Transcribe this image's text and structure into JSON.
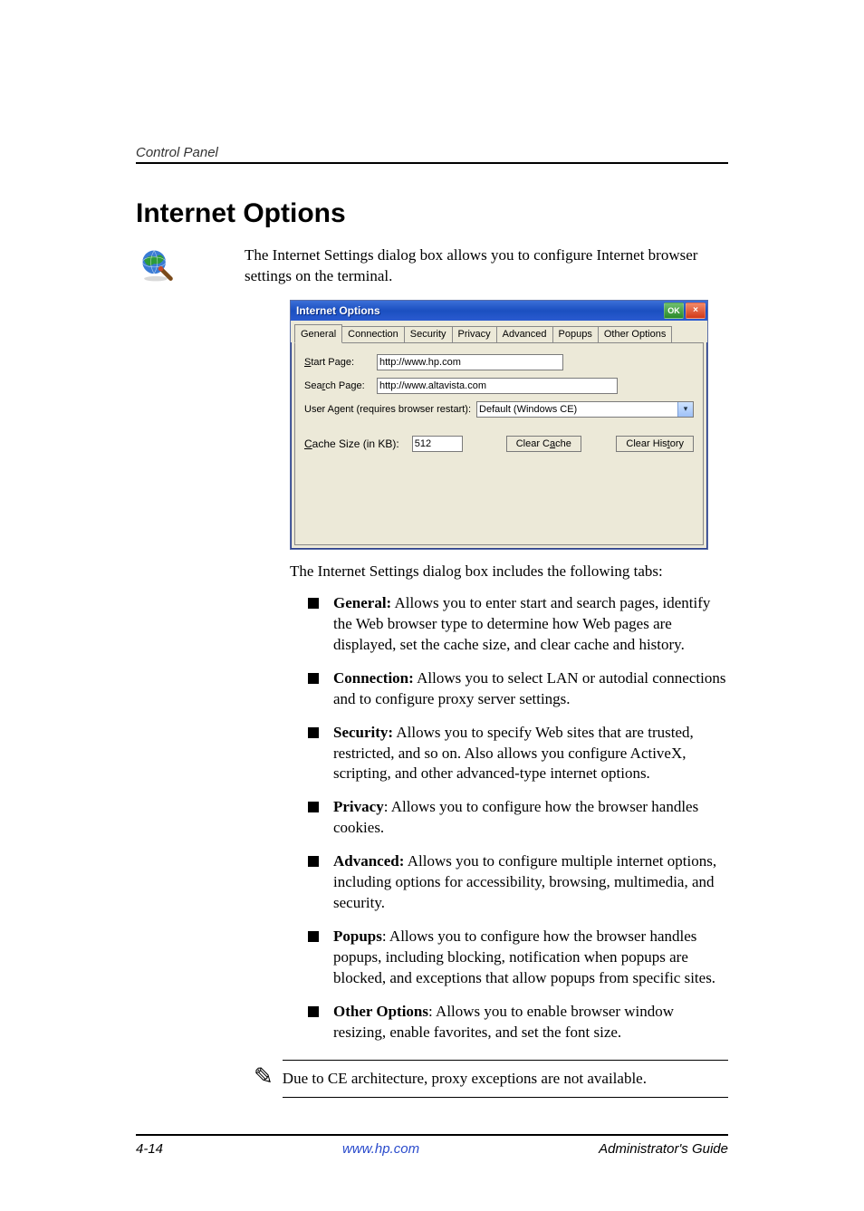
{
  "header": {
    "section": "Control Panel"
  },
  "title": "Internet Options",
  "intro": "The Internet Settings dialog box allows you to configure Internet browser settings on the terminal.",
  "dialog": {
    "title": "Internet Options",
    "ok_label": "OK",
    "close_label": "×",
    "tabs": [
      "General",
      "Connection",
      "Security",
      "Privacy",
      "Advanced",
      "Popups",
      "Other Options"
    ],
    "active_tab_index": 0,
    "general": {
      "start_page_label": "Start Page:",
      "start_page_value": "http://www.hp.com",
      "search_page_label": "Search Page:",
      "search_page_value": "http://www.altavista.com",
      "user_agent_label": "User Agent (requires browser restart):",
      "user_agent_value": "Default (Windows CE)",
      "cache_label": "Cache Size (in KB):",
      "cache_value": "512",
      "clear_cache_label": "Clear Cache",
      "clear_history_label": "Clear History"
    }
  },
  "after_dialog": "The Internet Settings dialog box includes the following tabs:",
  "tab_descriptions": [
    {
      "name": "General:",
      "text": " Allows you to enter start and search pages, identify the Web browser type to determine how Web pages are displayed, set the cache size, and clear cache and history."
    },
    {
      "name": "Connection:",
      "text": " Allows you to select LAN or autodial connections and to configure proxy server settings."
    },
    {
      "name": "Security:",
      "text": " Allows you to specify Web sites that are trusted, restricted, and so on. Also allows you configure ActiveX, scripting, and other advanced-type internet options."
    },
    {
      "name": "Privacy",
      "suffix": ":",
      "text": " Allows you to configure how the browser handles cookies."
    },
    {
      "name": "Advanced:",
      "text": " Allows you to configure multiple internet options, including options for accessibility, browsing, multimedia, and security."
    },
    {
      "name": "Popups",
      "suffix": ":",
      "text": " Allows you to configure how the browser handles popups, including blocking, notification when popups are blocked, and exceptions that allow popups from specific sites."
    },
    {
      "name": "Other Options",
      "suffix": ":",
      "text": " Allows you to enable browser window resizing, enable favorites, and set the font size."
    }
  ],
  "note": "Due to CE architecture, proxy exceptions are not available.",
  "footer": {
    "page": "4-14",
    "url": "www.hp.com",
    "doc": "Administrator's Guide"
  }
}
